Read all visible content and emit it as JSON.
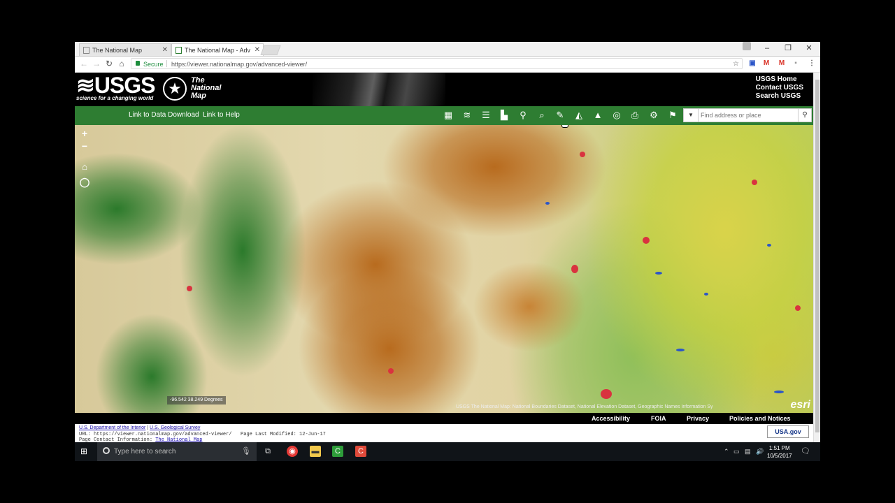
{
  "browser": {
    "tabs": [
      {
        "label": "The National Map",
        "active": false
      },
      {
        "label": "The National Map - Adv",
        "active": true
      }
    ],
    "secure_label": "Secure",
    "url": "https://viewer.nationalmap.gov/advanced-viewer/"
  },
  "header": {
    "usgs_word": "≋USGS",
    "usgs_tagline": "science for a changing world",
    "tnm_line1": "The",
    "tnm_line2": "National",
    "tnm_line3": "Map",
    "links": [
      "USGS Home",
      "Contact USGS",
      "Search USGS"
    ]
  },
  "toolbar": {
    "data_download": "Link to Data Download",
    "help": "Link to Help",
    "tools": [
      "basemap-gallery-icon",
      "layers-icon",
      "legend-icon",
      "bookmark-icon",
      "network-icon",
      "find-icon",
      "measure-icon",
      "elevation-profile-icon",
      "elevation-icon",
      "identify-icon",
      "print-icon",
      "settings-icon",
      "reporting-icon"
    ],
    "search_placeholder": "Find address or place"
  },
  "map": {
    "zoom_in": "+",
    "zoom_out": "−",
    "coords": "-96.542 38.249 Degrees",
    "attribution": "USGS The National Map: National Boundaries Dataset, National Elevation Dataset, Geographic Names Information Sy",
    "esri": "esri"
  },
  "footer_bar": {
    "links": [
      "Accessibility",
      "FOIA",
      "Privacy",
      "Policies and Notices"
    ]
  },
  "footer": {
    "doi": "U.S. Department of the Interior",
    "usgs": "U.S. Geological Survey",
    "url_line": "URL: https://viewer.nationalmap.gov/advanced-viewer/",
    "modified": "Page Last Modified: 12-Jun-17",
    "contact_label": "Page Contact Information:",
    "contact_link": "The National Map",
    "usagov": "USA.gov"
  },
  "taskbar": {
    "search_placeholder": "Type here to search",
    "time": "1:51 PM",
    "date": "10/5/2017"
  },
  "colors": {
    "usgs_green": "#2e7d32",
    "forest": "#2b7a2b",
    "shrub": "#b86b1e",
    "grass": "#e1d3a3",
    "crop": "#d9d34a",
    "developed": "#d9333f",
    "water": "#2b55c8"
  }
}
